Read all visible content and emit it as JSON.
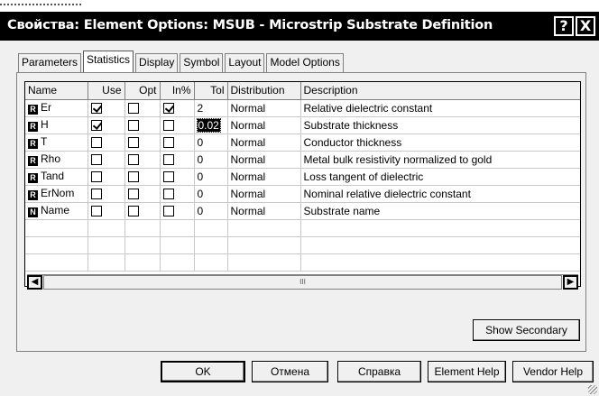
{
  "window": {
    "title": "Свойства: Element Options: MSUB - Microstrip Substrate Definition",
    "help_glyph": "?",
    "close_glyph": "X"
  },
  "tabs": [
    "Parameters",
    "Statistics",
    "Display",
    "Symbol",
    "Layout",
    "Model Options"
  ],
  "active_tab": "Statistics",
  "table": {
    "headers": {
      "name": "Name",
      "use": "Use",
      "opt": "Opt",
      "inpct": "In%",
      "tol": "Tol",
      "distribution": "Distribution",
      "description": "Description"
    },
    "rows": [
      {
        "badge": "R",
        "name": "Er",
        "use": true,
        "opt": false,
        "inpct": true,
        "tol": "2",
        "distribution": "Normal",
        "description": "Relative dielectric constant"
      },
      {
        "badge": "R",
        "name": "H",
        "use": true,
        "opt": false,
        "inpct": false,
        "tol": "0.02",
        "distribution": "Normal",
        "description": "Substrate thickness"
      },
      {
        "badge": "R",
        "name": "T",
        "use": false,
        "opt": false,
        "inpct": false,
        "tol": "0",
        "distribution": "Normal",
        "description": "Conductor thickness"
      },
      {
        "badge": "R",
        "name": "Rho",
        "use": false,
        "opt": false,
        "inpct": false,
        "tol": "0",
        "distribution": "Normal",
        "description": "Metal bulk resistivity normalized to gold"
      },
      {
        "badge": "R",
        "name": "Tand",
        "use": false,
        "opt": false,
        "inpct": false,
        "tol": "0",
        "distribution": "Normal",
        "description": "Loss tangent of dielectric"
      },
      {
        "badge": "R",
        "name": "ErNom",
        "use": false,
        "opt": false,
        "inpct": false,
        "tol": "0",
        "distribution": "Normal",
        "description": "Nominal relative dielectric constant"
      },
      {
        "badge": "N",
        "name": "Name",
        "use": false,
        "opt": false,
        "inpct": false,
        "tol": "0",
        "distribution": "Normal",
        "description": "Substrate name"
      }
    ],
    "selected_cell": "H.tol"
  },
  "scrollbar": {
    "left_arrow": "◀",
    "right_arrow": "▶",
    "grip": "III"
  },
  "buttons": {
    "show_secondary": "Show Secondary",
    "ok": "OK",
    "cancel": "Отмена",
    "help": "Справка",
    "element_help": "Element Help",
    "vendor_help": "Vendor Help"
  }
}
